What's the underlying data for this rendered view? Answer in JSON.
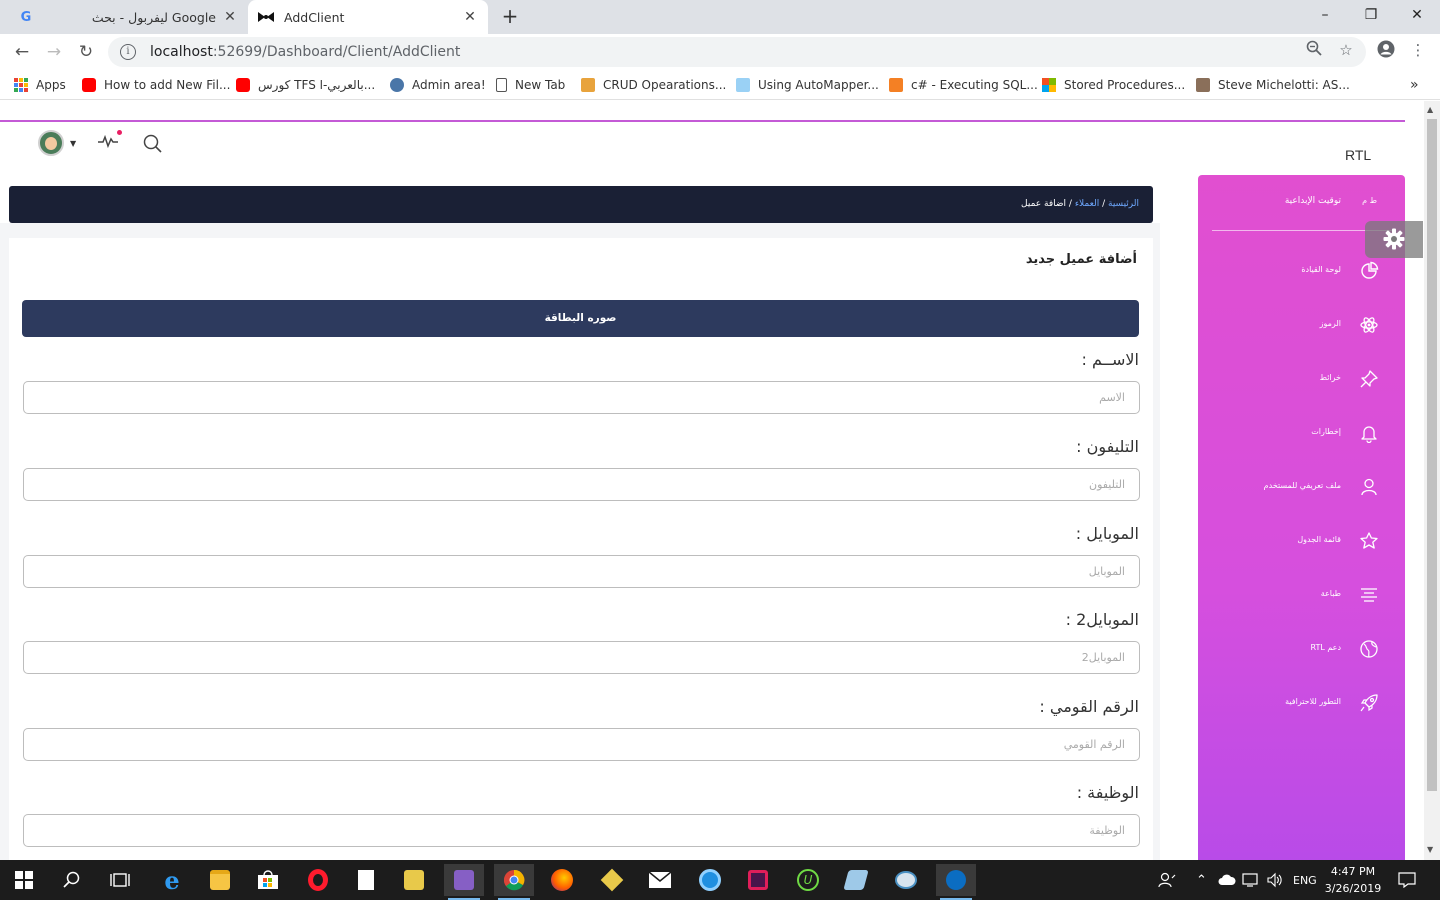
{
  "browser": {
    "tabs": [
      {
        "title": "ليفربول - بحث Google",
        "favicon": "google-icon",
        "active": false
      },
      {
        "title": "AddClient",
        "favicon": "bowtie-icon",
        "active": true
      }
    ],
    "url_host": "localhost",
    "url_path": ":52699/Dashboard/Client/AddClient",
    "bookmarks": [
      {
        "label": "Apps",
        "icon": "apps-grid-icon",
        "color": "#e8453c"
      },
      {
        "label": "How to add New Fil...",
        "icon": "youtube-icon",
        "color": "#ff0000"
      },
      {
        "label": "كورس TFS بالعربي-ا...",
        "icon": "youtube-icon",
        "color": "#ff0000"
      },
      {
        "label": "Admin area!",
        "icon": "bird-icon",
        "color": "#4a76a8"
      },
      {
        "label": "New Tab",
        "icon": "page-icon",
        "color": "#ffffff"
      },
      {
        "label": "CRUD Opearations...",
        "icon": "crud-icon",
        "color": "#e8a33c"
      },
      {
        "label": "Using AutoMapper...",
        "icon": "automapper-icon",
        "color": "#9ad1f5"
      },
      {
        "label": "c# - Executing SQL...",
        "icon": "stackoverflow-icon",
        "color": "#f48024"
      },
      {
        "label": "Stored Procedures...",
        "icon": "microsoft-icon",
        "color": "#7fba00"
      },
      {
        "label": "Steve Michelotti: AS...",
        "icon": "avatar-icon",
        "color": "#8a6f5a"
      }
    ]
  },
  "app": {
    "rtl_label": "RTL",
    "breadcrumb": {
      "home": "الرئيسية",
      "clients": "العملاء",
      "current": "اضافة عميل",
      "separator": "/"
    },
    "card_title": "أضافة عميل جديد",
    "upload_button": "صوره البطاقة",
    "fields": [
      {
        "label": "الاســم :",
        "placeholder": "الاسم"
      },
      {
        "label": "التليفون :",
        "placeholder": "التليفون"
      },
      {
        "label": "الموبايل :",
        "placeholder": "الموبايل"
      },
      {
        "label": "الموبايل2 :",
        "placeholder": "الموبايل2"
      },
      {
        "label": "الرقم القومي :",
        "placeholder": "الرقم القومي"
      },
      {
        "label": "الوظيفة :",
        "placeholder": "الوظيفة"
      }
    ],
    "sidebar": {
      "logo": "ط م",
      "brand": "توقيت الإبداعية",
      "accent": "#e14fd0",
      "items": [
        {
          "label": "لوحة القيادة",
          "icon": "dashboard-icon"
        },
        {
          "label": "الرموز",
          "icon": "atom-icon"
        },
        {
          "label": "خرائط",
          "icon": "pin-icon"
        },
        {
          "label": "إخطارات",
          "icon": "bell-icon"
        },
        {
          "label": "ملف تعريفي للمستخدم",
          "icon": "user-icon"
        },
        {
          "label": "قائمة الجدول",
          "icon": "puzzle-icon"
        },
        {
          "label": "طباعة",
          "icon": "align-center-icon"
        },
        {
          "label": "دعم RTL",
          "icon": "world-icon"
        },
        {
          "label": "التطور للاحترافية",
          "icon": "rocket-icon"
        }
      ]
    }
  },
  "taskbar": {
    "language": "ENG",
    "time": "4:47 PM",
    "date": "3/26/2019"
  }
}
